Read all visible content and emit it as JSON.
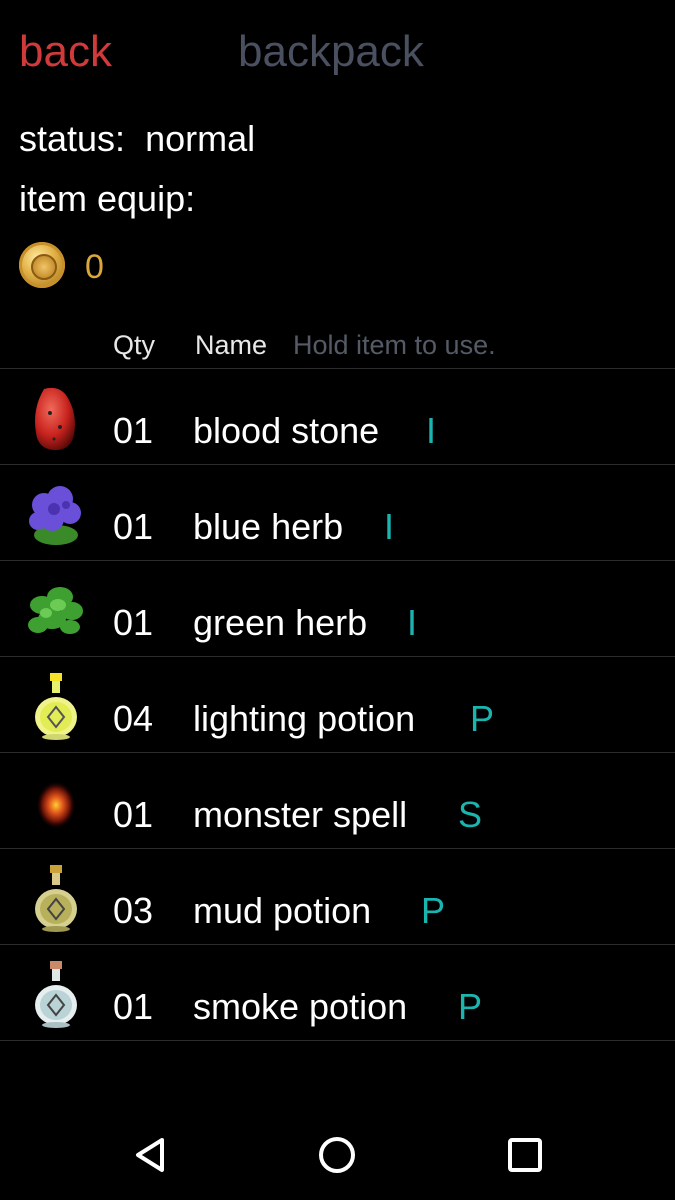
{
  "header": {
    "back_label": "back",
    "title": "backpack"
  },
  "status": {
    "label": "status:",
    "value": "normal"
  },
  "equip": {
    "label": "item equip:"
  },
  "coins": {
    "count": "0"
  },
  "table": {
    "col_qty": "Qty",
    "col_name": "Name",
    "hint": "Hold item to use."
  },
  "items": [
    {
      "qty": "01",
      "name": "blood stone",
      "type": "I",
      "icon": "blood-stone-icon"
    },
    {
      "qty": "01",
      "name": "blue herb",
      "type": "I",
      "icon": "blue-herb-icon"
    },
    {
      "qty": "01",
      "name": "green herb",
      "type": "I",
      "icon": "green-herb-icon"
    },
    {
      "qty": "04",
      "name": "lighting potion",
      "type": "P",
      "icon": "lighting-potion-icon"
    },
    {
      "qty": "01",
      "name": "monster spell",
      "type": "S",
      "icon": "monster-spell-icon"
    },
    {
      "qty": "03",
      "name": "mud potion",
      "type": "P",
      "icon": "mud-potion-icon"
    },
    {
      "qty": "01",
      "name": "smoke potion",
      "type": "P",
      "icon": "smoke-potion-icon"
    }
  ],
  "nav": {
    "back_icon": "triangle-back-icon",
    "home_icon": "circle-home-icon",
    "recents_icon": "square-recents-icon"
  },
  "colors": {
    "accent_back": "#d03a3a",
    "type_letter": "#1bb5b0",
    "coin_text": "#d9a73a"
  }
}
